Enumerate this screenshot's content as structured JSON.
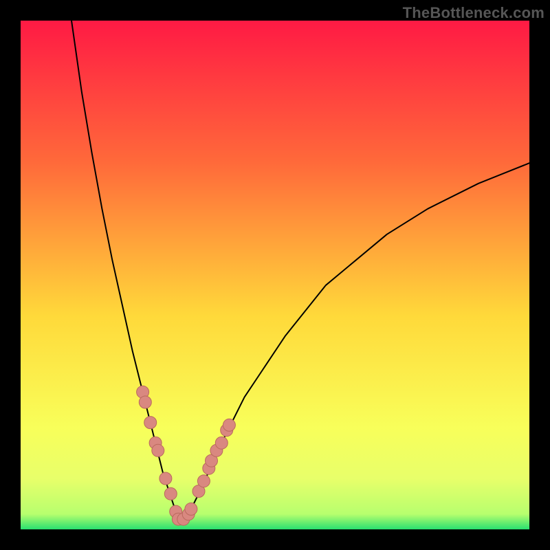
{
  "watermark": "TheBottleneck.com",
  "colors": {
    "frame_bg": "#000000",
    "gradient_top": "#ff1a44",
    "gradient_mid1": "#ff6a3a",
    "gradient_mid2": "#ffd93a",
    "gradient_low": "#f8ff5a",
    "gradient_band": "#e8ff6a",
    "gradient_green": "#28e070",
    "curve_stroke": "#000000",
    "marker_fill": "#d98880",
    "marker_stroke": "#b9695d"
  },
  "chart_data": {
    "type": "line",
    "title": "",
    "xlabel": "",
    "ylabel": "",
    "xlim": [
      0,
      100
    ],
    "ylim": [
      0,
      100
    ],
    "description": "Bottleneck curve: y rises sharply away from the minimum near x≈31, reaching 100 on the left near x≈10 and ≈72 on the right at x=100; y≈0 at the trough.",
    "series": [
      {
        "name": "bottleneck-curve",
        "x": [
          10,
          12,
          14,
          16,
          18,
          20,
          22,
          24,
          26,
          28,
          29,
          30,
          31,
          32,
          33,
          34,
          36,
          38,
          40,
          44,
          48,
          52,
          56,
          60,
          66,
          72,
          80,
          90,
          100
        ],
        "values": [
          100,
          86,
          74,
          63,
          53,
          44,
          35,
          27,
          19,
          11,
          8,
          5,
          2,
          2,
          3,
          5,
          9,
          14,
          18,
          26,
          32,
          38,
          43,
          48,
          53,
          58,
          63,
          68,
          72
        ]
      }
    ],
    "markers": {
      "name": "highlighted-points",
      "x": [
        24.0,
        24.5,
        25.5,
        26.5,
        27.0,
        28.5,
        29.5,
        30.5,
        31.0,
        32.0,
        33.0,
        33.5,
        35.0,
        36.0,
        37.0,
        37.5,
        38.5,
        39.5,
        40.5,
        41.0
      ],
      "values": [
        27.0,
        25.0,
        21.0,
        17.0,
        15.5,
        10.0,
        7.0,
        3.5,
        2.0,
        2.0,
        3.0,
        4.0,
        7.5,
        9.5,
        12.0,
        13.5,
        15.5,
        17.0,
        19.5,
        20.5
      ]
    }
  }
}
